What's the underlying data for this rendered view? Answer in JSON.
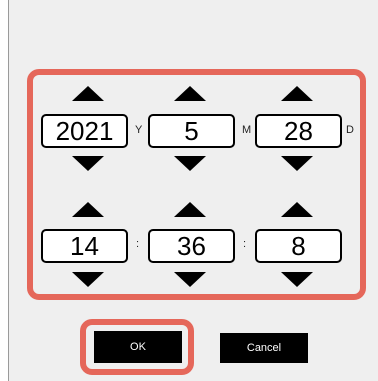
{
  "date": {
    "year": "2021",
    "month": "5",
    "day": "28",
    "year_unit": "Y",
    "month_unit": "M",
    "day_unit": "D"
  },
  "time": {
    "hour": "14",
    "minute": "36",
    "second": "8",
    "separator": ":"
  },
  "buttons": {
    "ok_label": "OK",
    "cancel_label": "Cancel"
  },
  "colors": {
    "highlight": "#e5675a",
    "panel_background": "#efefef"
  },
  "icons": {
    "increment": "triangle-up-icon",
    "decrement": "triangle-down-icon"
  }
}
